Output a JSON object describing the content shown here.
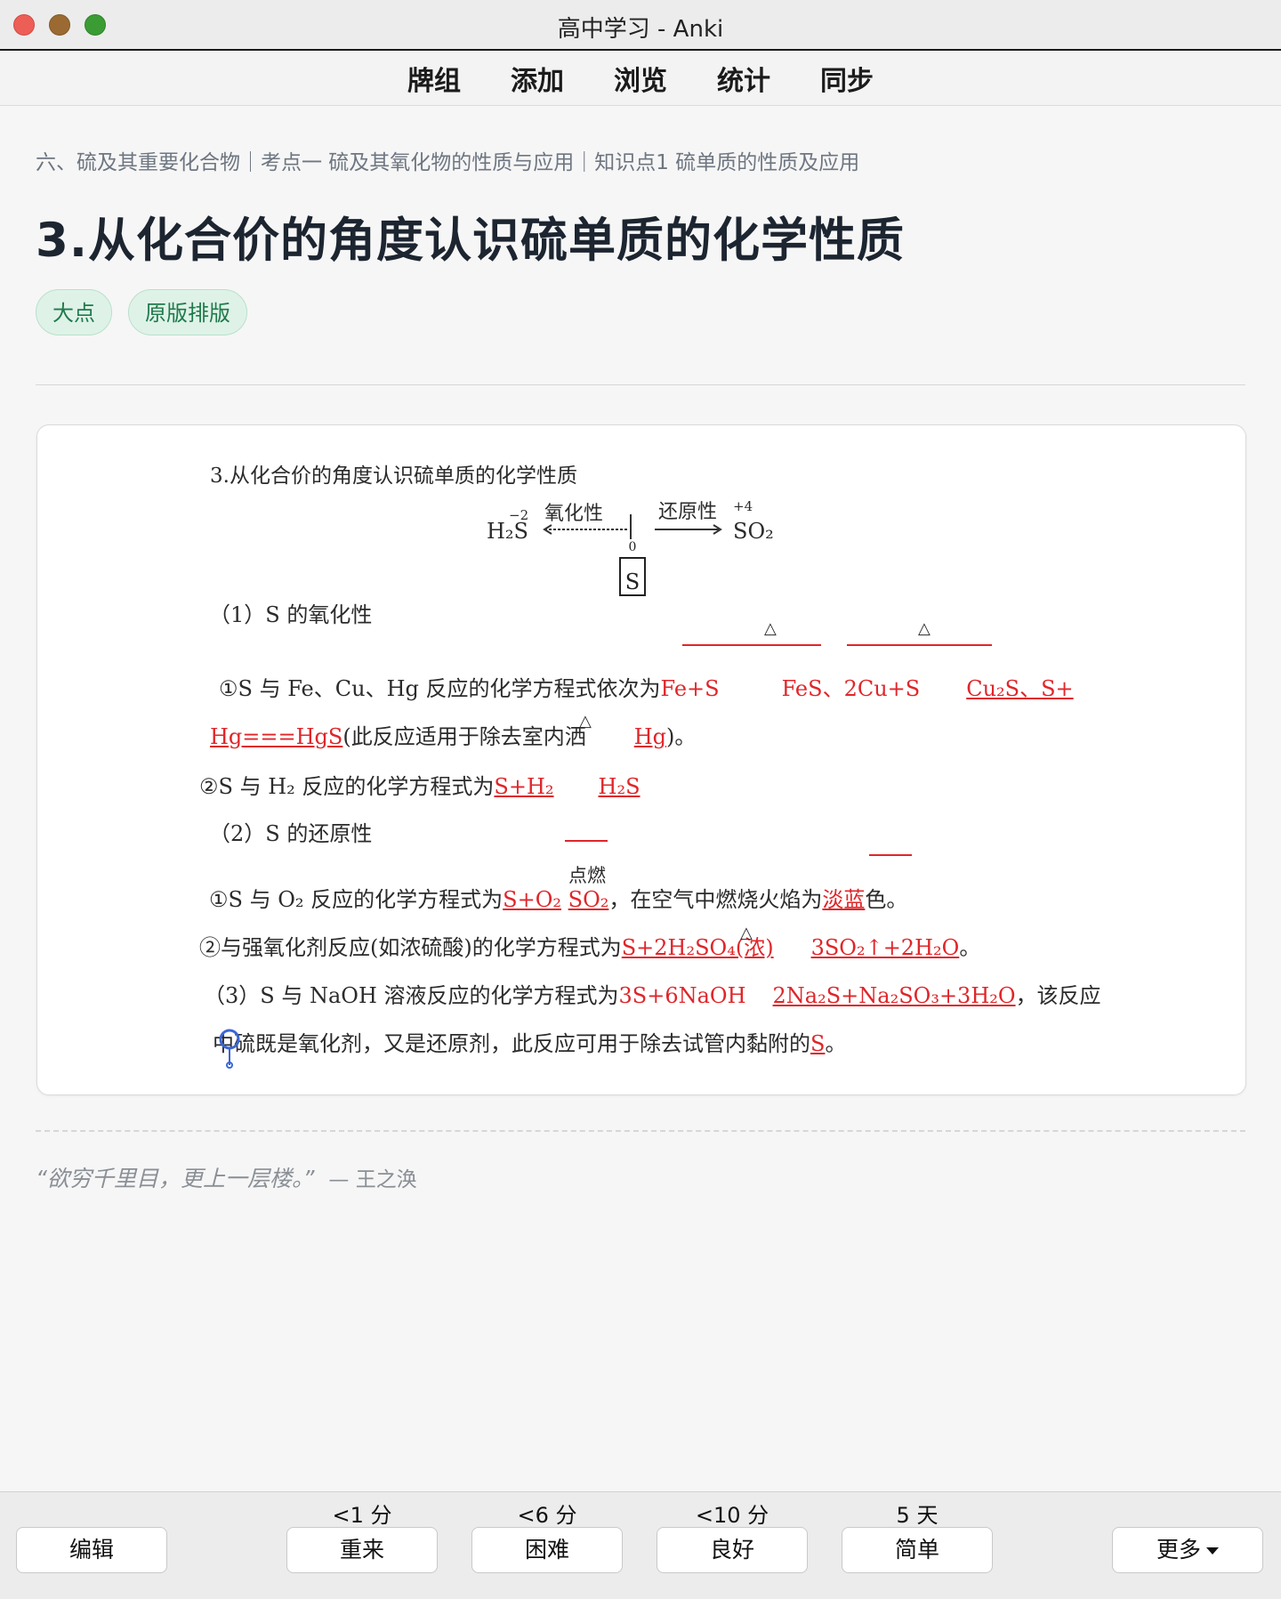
{
  "window": {
    "title": "高中学习 - Anki"
  },
  "nav": {
    "items": [
      "牌组",
      "添加",
      "浏览",
      "统计",
      "同步"
    ]
  },
  "breadcrumb": "六、硫及其重要化合物｜考点一 硫及其氧化物的性质与应用｜知识点1 硫单质的性质及应用",
  "page_title": "3.从化合价的角度认识硫单质的化学性质",
  "tags": [
    "大点",
    "原版排版"
  ],
  "card": {
    "heading": "3.从化合价的角度认识硫单质的化学性质",
    "diagram": {
      "left": "H₂S",
      "left_valence": "−2",
      "left_arrow_label": "氧化性",
      "right_arrow_label": "还原性",
      "right_valence": "+4",
      "right": "SO₂",
      "center": "S",
      "center_valence": "0"
    },
    "s1_heading": "（1）S 的氧化性",
    "s1_l1_prefix": "①S 与 Fe、Cu、Hg 反应的化学方程式依次为",
    "s1_l1_a": "Fe+S",
    "s1_l1_b": "FeS、2Cu+S",
    "s1_l1_c": "Cu₂S、S+",
    "s1_l2_a": "Hg===HgS",
    "s1_l2_b": "(此反应适用于除去室内洒",
    "s1_l2_c": "Hg",
    "s1_l2_d": ")。",
    "s1_l3_prefix": "②S 与 H₂ 反应的化学方程式为",
    "s1_l3_a": "S+H₂",
    "s1_l3_b": "H₂S",
    "s2_heading": "（2）S 的还原性",
    "cond_fire": "点燃",
    "cond_heat": "△",
    "s2_l1_prefix": "①S 与 O₂ 反应的化学方程式为",
    "s2_l1_a": "S+O₂",
    "s2_l1_b": "SO₂",
    "s2_l1_c": "，在空气中燃烧火焰为",
    "s2_l1_d": "淡蓝",
    "s2_l1_e": "色。",
    "s2_l2_prefix": "②与强氧化剂反应(如浓硫酸)的化学方程式为",
    "s2_l2_a": "S+2H₂SO₄(浓)",
    "s2_l2_b": "3SO₂↑+2H₂O",
    "s2_l2_c": "。",
    "s3_l1_prefix": "（3）S 与 NaOH 溶液反应的化学方程式为",
    "s3_l1_a": "3S+6NaOH",
    "s3_l1_b": "2Na₂S+Na₂SO₃+3H₂O",
    "s3_l1_c": "，该反应",
    "s3_l2_a": "中硫既是氧化剂，又是还原剂，此反应可用于除去试管内黏附的",
    "s3_l2_b": "S",
    "s3_l2_c": "。"
  },
  "quote": {
    "text": "“欲穷千里目，更上一层楼。”",
    "author": "— 王之涣"
  },
  "bottom": {
    "edit": "编辑",
    "more": "更多",
    "answers": [
      {
        "label": "重来",
        "interval": "<1 分"
      },
      {
        "label": "困难",
        "interval": "<6 分"
      },
      {
        "label": "良好",
        "interval": "<10 分"
      },
      {
        "label": "简单",
        "interval": "5 天"
      }
    ]
  }
}
